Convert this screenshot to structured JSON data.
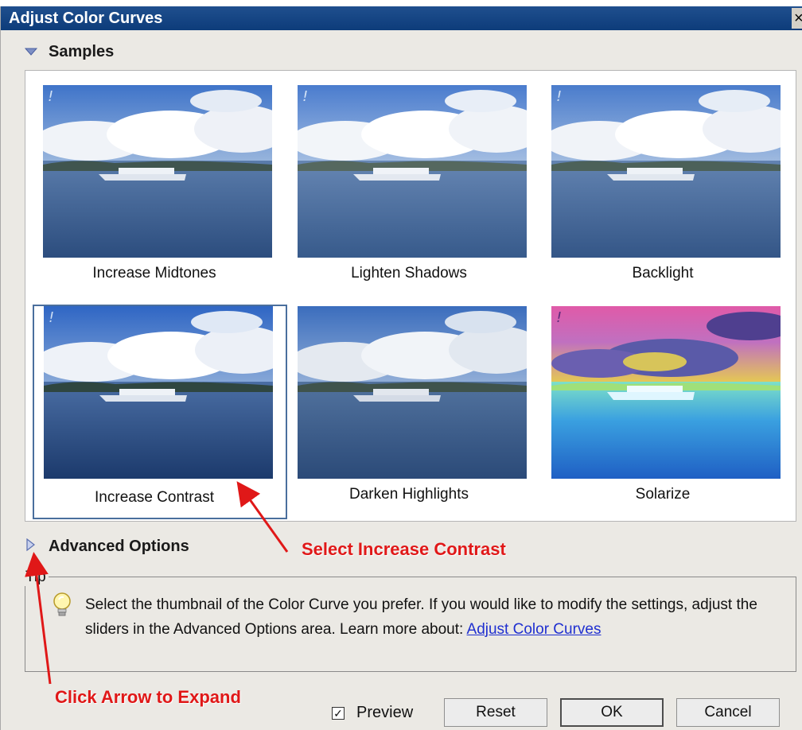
{
  "window": {
    "title": "Adjust Color Curves",
    "close_glyph": "×"
  },
  "samples": {
    "header": "Samples",
    "items": [
      {
        "label": "Increase Midtones",
        "selected": false
      },
      {
        "label": "Lighten Shadows",
        "selected": false
      },
      {
        "label": "Backlight",
        "selected": false
      },
      {
        "label": "Increase Contrast",
        "selected": true
      },
      {
        "label": "Darken Highlights",
        "selected": false
      },
      {
        "label": "Solarize",
        "selected": false
      }
    ]
  },
  "advanced": {
    "header": "Advanced Options",
    "expanded": false
  },
  "tip": {
    "legend": "Tip",
    "text": "Select the thumbnail of the Color Curve you prefer. If you would like to modify the settings, adjust the sliders in the Advanced Options area. Learn more about: ",
    "link": "Adjust Color Curves"
  },
  "annotations": {
    "select": "Select Increase Contrast",
    "expand": "Click Arrow to Expand"
  },
  "footer": {
    "preview_label": "Preview",
    "preview_checked": true,
    "reset": "Reset",
    "ok": "OK",
    "cancel": "Cancel"
  },
  "colors": {
    "title_bar": "#1f4f8e",
    "annotation_red": "#e01818",
    "selection_border": "#4a6f9d",
    "link": "#1f2fd0"
  }
}
